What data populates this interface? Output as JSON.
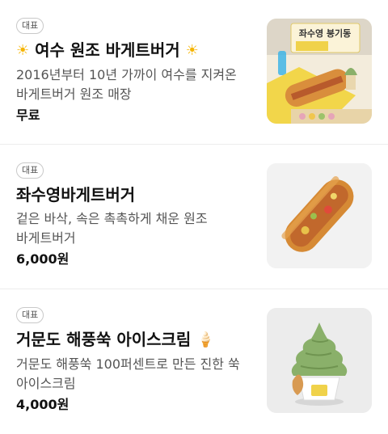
{
  "menu": {
    "items": [
      {
        "badge": "대표",
        "name_icon": "sun-icon",
        "name_icon_glyph": "☀",
        "name": "여수 원조 바게트버거",
        "description": "2016년부터 10년 가까이 여수를 지켜온 바게트버거 원조 매장",
        "price": "무료",
        "image": "baguette-burger-shop-photo",
        "image_sign_text": "좌수영 붕기동"
      },
      {
        "badge": "대표",
        "name": "좌수영바게트버거",
        "description": "겉은 바삭, 속은 촉촉하게 채운 원조 바게트버거",
        "price": "6,000원",
        "image": "baguette-burger-photo"
      },
      {
        "badge": "대표",
        "name_icon": "ice-cream-icon",
        "name_icon_glyph": "🍦",
        "name": "거문도 해풍쑥 아이스크림",
        "description": "거문도 해풍쑥 100퍼센트로 만든 진한 쑥 아이스크림",
        "price": "4,000원",
        "image": "mugwort-ice-cream-photo"
      }
    ]
  },
  "colors": {
    "accent_sun": "#f5b400",
    "divider": "#ececec",
    "mugwort_green": "#8ab06a"
  }
}
